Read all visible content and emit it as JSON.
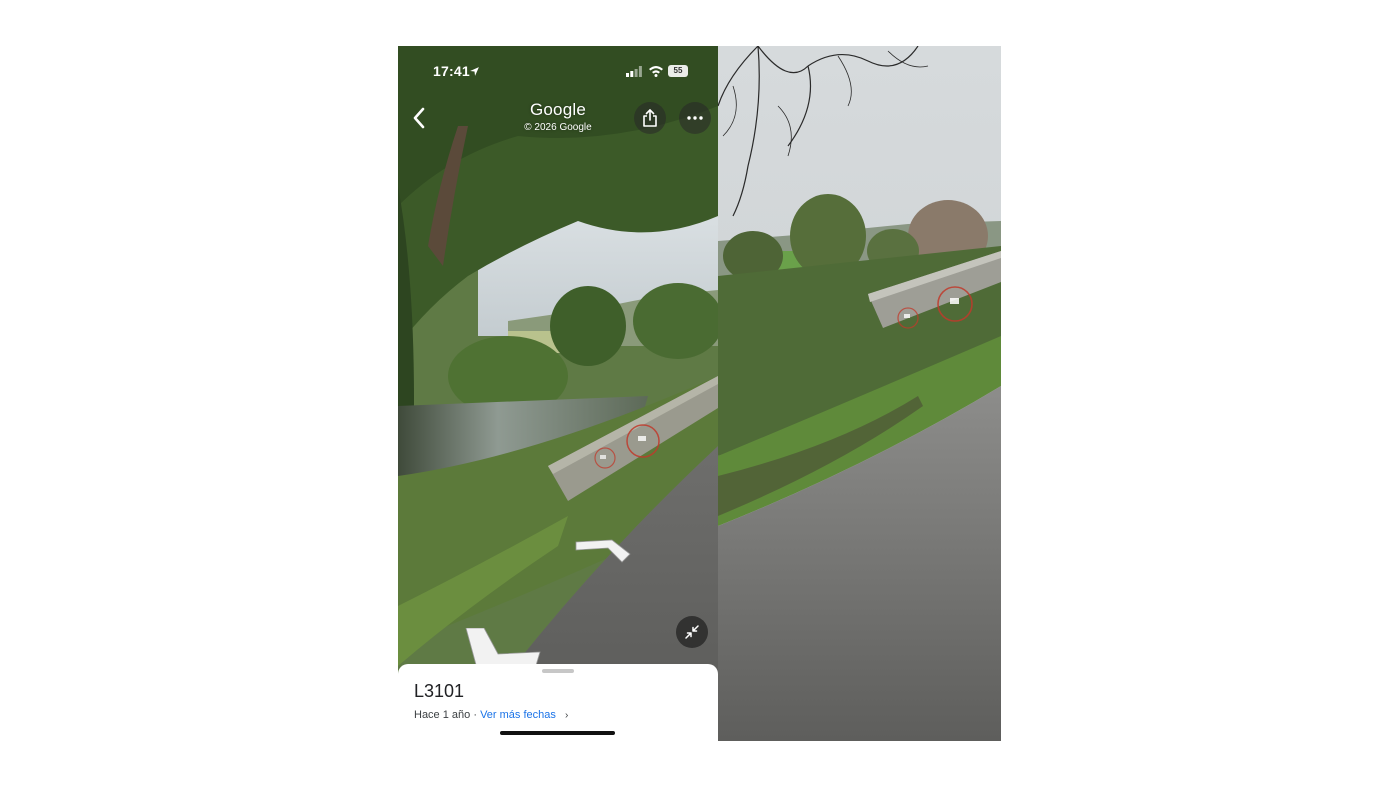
{
  "status_bar": {
    "time": "17:41",
    "battery": "55"
  },
  "header": {
    "logo": "Google",
    "copyright": "© 2026 Google"
  },
  "icons": {
    "back": "chevron-left-icon",
    "share": "share-icon",
    "more": "more-horizontal-icon",
    "collapse": "collapse-icon",
    "nav_arrow": "navigation-arrow-icon"
  },
  "bottom_sheet": {
    "road_name": "L3101",
    "age": "Hace 1 año",
    "separator": "·",
    "more_dates_link": "Ver más fechas",
    "more_dates_chevron": "›"
  },
  "colors": {
    "link": "#1a73e8",
    "annotation_circle": "#c0392b"
  }
}
